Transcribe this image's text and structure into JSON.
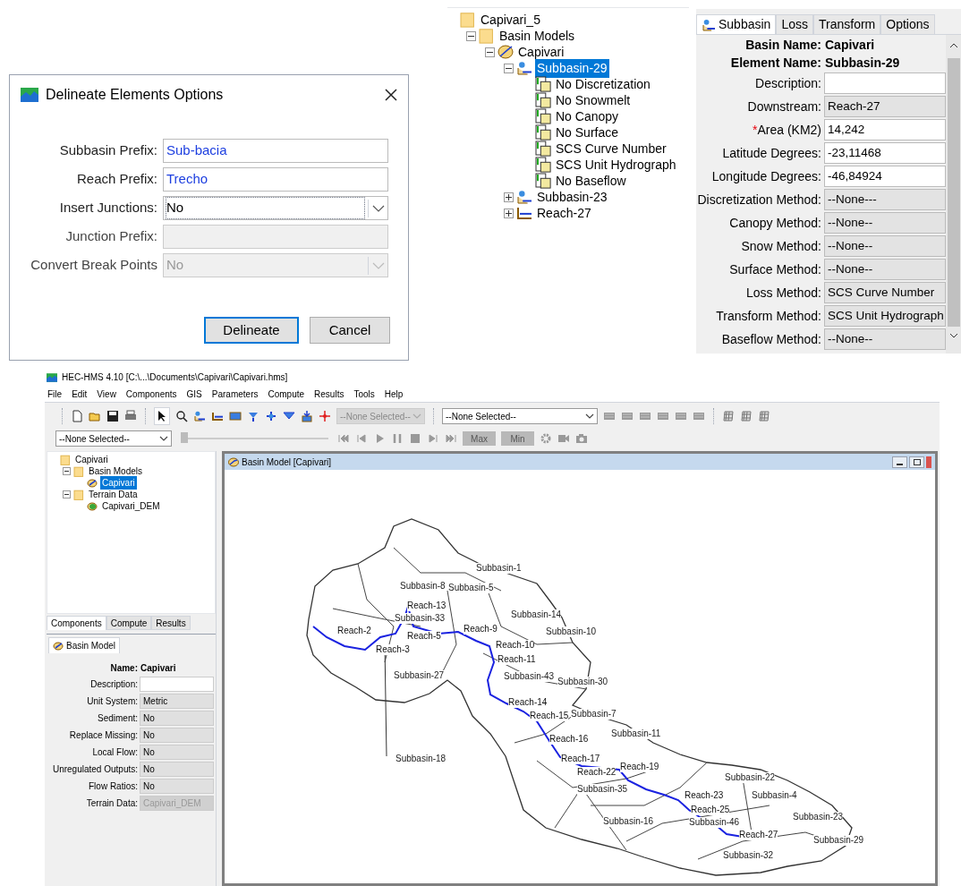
{
  "delineate_dialog": {
    "title": "Delineate Elements Options",
    "fields": [
      {
        "label": "Subbasin Prefix:",
        "value": "Sub-bacia",
        "kind": "text",
        "disabled": false
      },
      {
        "label": "Reach Prefix:",
        "value": "Trecho",
        "kind": "text",
        "disabled": false
      },
      {
        "label": "Insert Junctions:",
        "value": "No",
        "kind": "dropdown",
        "disabled": false
      },
      {
        "label": "Junction Prefix:",
        "kind": "text",
        "disabled": true
      },
      {
        "label": "Convert Break Points",
        "value": "No",
        "kind": "dropdown",
        "disabled": true
      }
    ],
    "buttons": [
      {
        "label": "Delineate",
        "default": true
      },
      {
        "label": "Cancel",
        "default": false
      }
    ]
  },
  "project_tree": {
    "items": [
      {
        "label": "Capivari_5",
        "kind": "folder",
        "selected": false,
        "children": [
          {
            "label": "Basin Models",
            "kind": "folder",
            "expanded": true,
            "selected": false,
            "children": [
              {
                "label": "Capivari",
                "kind": "basin",
                "expanded": true,
                "selected": false,
                "children": [
                  {
                    "label": "Subbasin-29",
                    "kind": "subbasin",
                    "expanded": true,
                    "selected": true,
                    "children": [
                      {
                        "label": "No Discretization",
                        "kind": "method",
                        "selected": false
                      },
                      {
                        "label": "No Snowmelt",
                        "kind": "method",
                        "selected": false
                      },
                      {
                        "label": "No Canopy",
                        "kind": "method",
                        "selected": false
                      },
                      {
                        "label": "No Surface",
                        "kind": "method",
                        "selected": false
                      },
                      {
                        "label": "SCS Curve Number",
                        "kind": "method",
                        "selected": false
                      },
                      {
                        "label": "SCS Unit Hydrograph",
                        "kind": "method",
                        "selected": false
                      },
                      {
                        "label": "No Baseflow",
                        "kind": "method",
                        "selected": false
                      }
                    ]
                  },
                  {
                    "label": "Subbasin-23",
                    "kind": "subbasin",
                    "expanded": false,
                    "selected": false
                  },
                  {
                    "label": "Reach-27",
                    "kind": "reach",
                    "expanded": false,
                    "selected": false
                  }
                ]
              }
            ]
          }
        ]
      }
    ]
  },
  "subbasin_editor": {
    "tabs": [
      {
        "label": "Subbasin",
        "selected": true
      },
      {
        "label": "Loss",
        "selected": false
      },
      {
        "label": "Transform",
        "selected": false
      },
      {
        "label": "Options",
        "selected": false
      }
    ],
    "header": [
      {
        "label": "Basin Name:",
        "value": "Capivari"
      },
      {
        "label": "Element Name:",
        "value": "Subbasin-29"
      }
    ],
    "fields": [
      {
        "label": "Description:",
        "kind": "text"
      },
      {
        "label": "Downstream:",
        "value": "Reach-27",
        "kind": "dropdown"
      },
      {
        "label": "Area (KM2)",
        "value": "14,242",
        "kind": "text",
        "required_mark": "*"
      },
      {
        "label": "Latitude Degrees:",
        "value": "-23,11468",
        "kind": "text"
      },
      {
        "label": "Longitude Degrees:",
        "value": "-46,84924",
        "kind": "text"
      },
      {
        "label": "Discretization Method:",
        "value": "--None---",
        "kind": "dropdown"
      },
      {
        "label": "Canopy Method:",
        "value": "--None--",
        "kind": "dropdown"
      },
      {
        "label": "Snow Method:",
        "value": "--None--",
        "kind": "dropdown"
      },
      {
        "label": "Surface Method:",
        "value": "--None--",
        "kind": "dropdown"
      },
      {
        "label": "Loss Method:",
        "value": "SCS Curve Number",
        "kind": "dropdown"
      },
      {
        "label": "Transform Method:",
        "value": "SCS Unit Hydrograph",
        "kind": "dropdown"
      },
      {
        "label": "Baseflow Method:",
        "value": "--None--",
        "kind": "dropdown"
      }
    ]
  },
  "app": {
    "title": "HEC-HMS 4.10 [C:\\...\\Documents\\Capivari\\Capivari.hms]",
    "menu": [
      "File",
      "Edit",
      "View",
      "Components",
      "GIS",
      "Parameters",
      "Compute",
      "Results",
      "Tools",
      "Help"
    ],
    "toolbar": {
      "element_select": {
        "value": "--None Selected--",
        "disabled": true
      },
      "run_select": {
        "value": "--None Selected--",
        "disabled": false
      },
      "time_select": {
        "value": "--None Selected--"
      },
      "time_slider": {
        "level": 0
      },
      "buttons": [
        {
          "label": "Max",
          "disabled": true
        },
        {
          "label": "Min",
          "disabled": true
        }
      ]
    },
    "watershed_tree": {
      "items": [
        {
          "label": "Capivari",
          "kind": "folder",
          "selected": false,
          "children": [
            {
              "label": "Basin Models",
              "kind": "folder",
              "expanded": true,
              "selected": false,
              "children": [
                {
                  "label": "Capivari",
                  "kind": "basin",
                  "selected": true
                }
              ]
            },
            {
              "label": "Terrain Data",
              "kind": "folder",
              "expanded": true,
              "selected": false,
              "children": [
                {
                  "label": "Capivari_DEM",
                  "kind": "terrain",
                  "selected": false
                }
              ]
            }
          ]
        }
      ]
    },
    "panel_tabs": [
      {
        "label": "Components",
        "selected": true
      },
      {
        "label": "Compute",
        "selected": false
      },
      {
        "label": "Results",
        "selected": false
      }
    ],
    "component_editor": {
      "tab": "Basin Model",
      "header": [
        {
          "label": "Name:",
          "value": "Capivari"
        }
      ],
      "fields": [
        {
          "label": "Description:",
          "kind": "text",
          "disabled": false
        },
        {
          "label": "Unit System:",
          "value": "Metric",
          "kind": "dropdown",
          "disabled": false
        },
        {
          "label": "Sediment:",
          "value": "No",
          "kind": "dropdown",
          "disabled": false
        },
        {
          "label": "Replace Missing:",
          "value": "No",
          "kind": "dropdown",
          "disabled": false
        },
        {
          "label": "Local Flow:",
          "value": "No",
          "kind": "dropdown",
          "disabled": false
        },
        {
          "label": "Unregulated Outputs:",
          "value": "No",
          "kind": "dropdown",
          "disabled": false
        },
        {
          "label": "Flow Ratios:",
          "value": "No",
          "kind": "dropdown",
          "disabled": false
        },
        {
          "label": "Terrain Data:",
          "value": "Capivari_DEM",
          "kind": "dropdown",
          "disabled": true
        }
      ]
    },
    "basin_window": {
      "title": "Basin Model [Capivari]",
      "map_labels": [
        {
          "text": "Subbasin-1",
          "kind": "subbasin"
        },
        {
          "text": "Subbasin-8",
          "kind": "subbasin"
        },
        {
          "text": "Subbasin-5",
          "kind": "subbasin"
        },
        {
          "text": "Reach-13",
          "kind": "reach"
        },
        {
          "text": "Subbasin-33",
          "kind": "subbasin"
        },
        {
          "text": "Subbasin-14",
          "kind": "subbasin"
        },
        {
          "text": "Reach-2",
          "kind": "reach"
        },
        {
          "text": "Reach-5",
          "kind": "reach"
        },
        {
          "text": "Reach-9",
          "kind": "reach"
        },
        {
          "text": "Subbasin-10",
          "kind": "subbasin"
        },
        {
          "text": "Reach-3",
          "kind": "reach"
        },
        {
          "text": "Reach-10",
          "kind": "reach"
        },
        {
          "text": "Reach-11",
          "kind": "reach"
        },
        {
          "text": "Subbasin-27",
          "kind": "subbasin"
        },
        {
          "text": "Subbasin-43",
          "kind": "subbasin"
        },
        {
          "text": "Subbasin-30",
          "kind": "subbasin"
        },
        {
          "text": "Reach-14",
          "kind": "reach"
        },
        {
          "text": "Reach-15",
          "kind": "reach"
        },
        {
          "text": "Subbasin-7",
          "kind": "subbasin"
        },
        {
          "text": "Reach-16",
          "kind": "reach"
        },
        {
          "text": "Subbasin-11",
          "kind": "subbasin"
        },
        {
          "text": "Reach-17",
          "kind": "reach"
        },
        {
          "text": "Subbasin-18",
          "kind": "subbasin"
        },
        {
          "text": "Reach-19",
          "kind": "reach"
        },
        {
          "text": "Reach-22",
          "kind": "reach"
        },
        {
          "text": "Subbasin-35",
          "kind": "subbasin"
        },
        {
          "text": "Subbasin-22",
          "kind": "subbasin"
        },
        {
          "text": "Subbasin-4",
          "kind": "subbasin"
        },
        {
          "text": "Reach-23",
          "kind": "reach"
        },
        {
          "text": "Reach-25",
          "kind": "reach"
        },
        {
          "text": "Subbasin-16",
          "kind": "subbasin"
        },
        {
          "text": "Subbasin-46",
          "kind": "subbasin"
        },
        {
          "text": "Subbasin-23",
          "kind": "subbasin"
        },
        {
          "text": "Reach-27",
          "kind": "reach"
        },
        {
          "text": "Subbasin-29",
          "kind": "subbasin"
        },
        {
          "text": "Subbasin-32",
          "kind": "subbasin"
        }
      ]
    }
  }
}
